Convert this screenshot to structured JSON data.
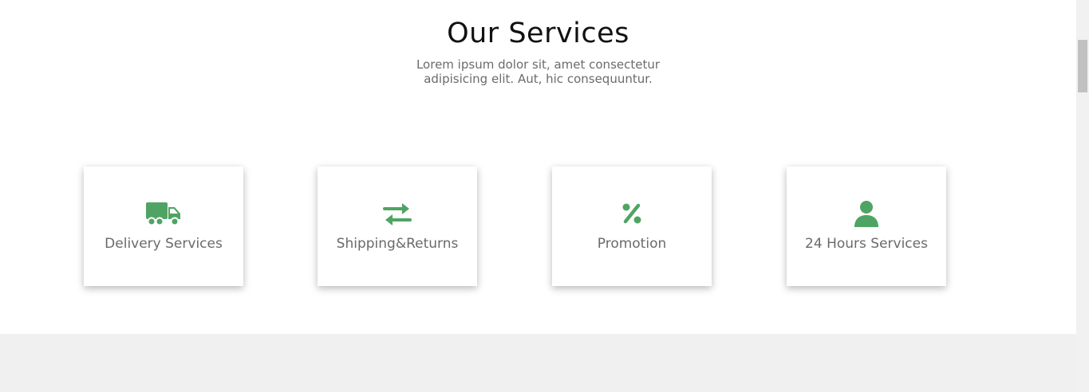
{
  "section": {
    "title": "Our Services",
    "subtitle": "Lorem ipsum dolor sit, amet consectetur adipisicing elit. Aut, hic consequuntur."
  },
  "accent_color": "#4fa463",
  "services": [
    {
      "label": "Delivery Services",
      "icon": "truck-icon"
    },
    {
      "label": "Shipping&Returns",
      "icon": "exchange-arrows-icon"
    },
    {
      "label": "Promotion",
      "icon": "percent-icon"
    },
    {
      "label": "24 Hours Services",
      "icon": "user-icon"
    }
  ]
}
